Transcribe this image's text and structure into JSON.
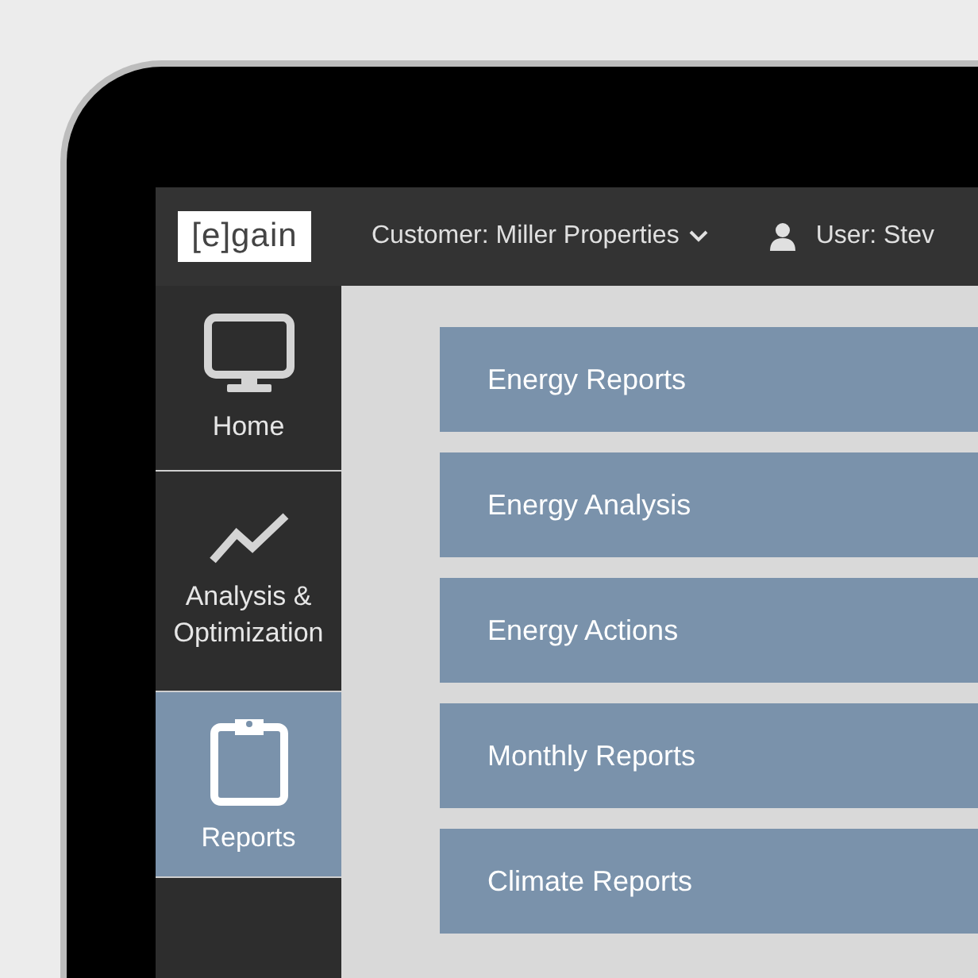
{
  "header": {
    "logo": "[e]gain",
    "customer": "Customer: Miller Properties",
    "user": "User: Stev"
  },
  "sidebar": {
    "items": [
      {
        "kind": "monitor",
        "label": "Home",
        "selected": false
      },
      {
        "kind": "trend",
        "label": "Analysis & Optimization",
        "selected": false
      },
      {
        "kind": "clipboard",
        "label": "Reports",
        "selected": true
      }
    ]
  },
  "menu": {
    "items": [
      {
        "label": "Energy Reports"
      },
      {
        "label": "Energy Analysis"
      },
      {
        "label": "Energy Actions"
      },
      {
        "label": "Monthly Reports"
      },
      {
        "label": "Climate Reports"
      }
    ]
  }
}
